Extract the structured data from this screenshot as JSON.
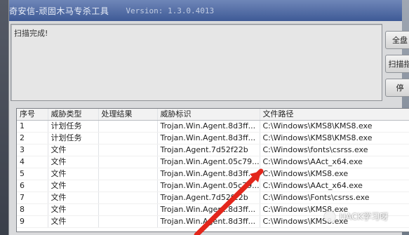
{
  "window": {
    "title": "奇安信-顽固木马专杀工具",
    "version": "Version: 1.3.0.4013"
  },
  "status": {
    "message": "扫描完成!"
  },
  "side_buttons": [
    {
      "label": "全盘"
    },
    {
      "label": "扫描指"
    },
    {
      "label": "停"
    }
  ],
  "table": {
    "headers": [
      "序号",
      "威胁类型",
      "处理结果",
      "威胁标识",
      "文件路径"
    ],
    "rows": [
      {
        "num": "1",
        "type": "计划任务",
        "result": "",
        "id": "Trojan.Win.Agent.8d3ff...",
        "path": "C:\\Windows\\KMS8\\KMS8.exe"
      },
      {
        "num": "2",
        "type": "计划任务",
        "result": "",
        "id": "Trojan.Win.Agent.8d3ff...",
        "path": "C:\\Windows\\KMS8\\KMS8.exe"
      },
      {
        "num": "3",
        "type": "文件",
        "result": "",
        "id": "Trojan.Agent.7d52f22b",
        "path": "C:\\Windows\\fonts\\csrss.exe"
      },
      {
        "num": "4",
        "type": "文件",
        "result": "",
        "id": "Trojan.Win.Agent.05c79...",
        "path": "C:\\Windows\\AAct_x64.exe"
      },
      {
        "num": "5",
        "type": "文件",
        "result": "",
        "id": "Trojan.Win.Agent.8d3ff...",
        "path": "C:\\Windows\\KMS8.exe"
      },
      {
        "num": "6",
        "type": "文件",
        "result": "",
        "id": "Trojan.Win.Agent.05c79...",
        "path": "C:\\Windows\\AAct_x64.exe"
      },
      {
        "num": "7",
        "type": "文件",
        "result": "",
        "id": "Trojan.Agent.7d52f22b",
        "path": "C:\\Windows\\Fonts\\csrss.exe"
      },
      {
        "num": "8",
        "type": "文件",
        "result": "",
        "id": "Trojan.Win.Agent.8d3ff...",
        "path": "C:\\Windows\\KMS8.exe"
      },
      {
        "num": "9",
        "type": "文件",
        "result": "",
        "id": "Trojan.Win.Agent.8d3ff...",
        "path": "C:\\Windows\\KMS8.exe"
      }
    ]
  },
  "watermark": {
    "text": "HACK学习呀"
  },
  "colors": {
    "titlebar": "#3e5a96",
    "annotation_arrow": "#e3261b"
  }
}
